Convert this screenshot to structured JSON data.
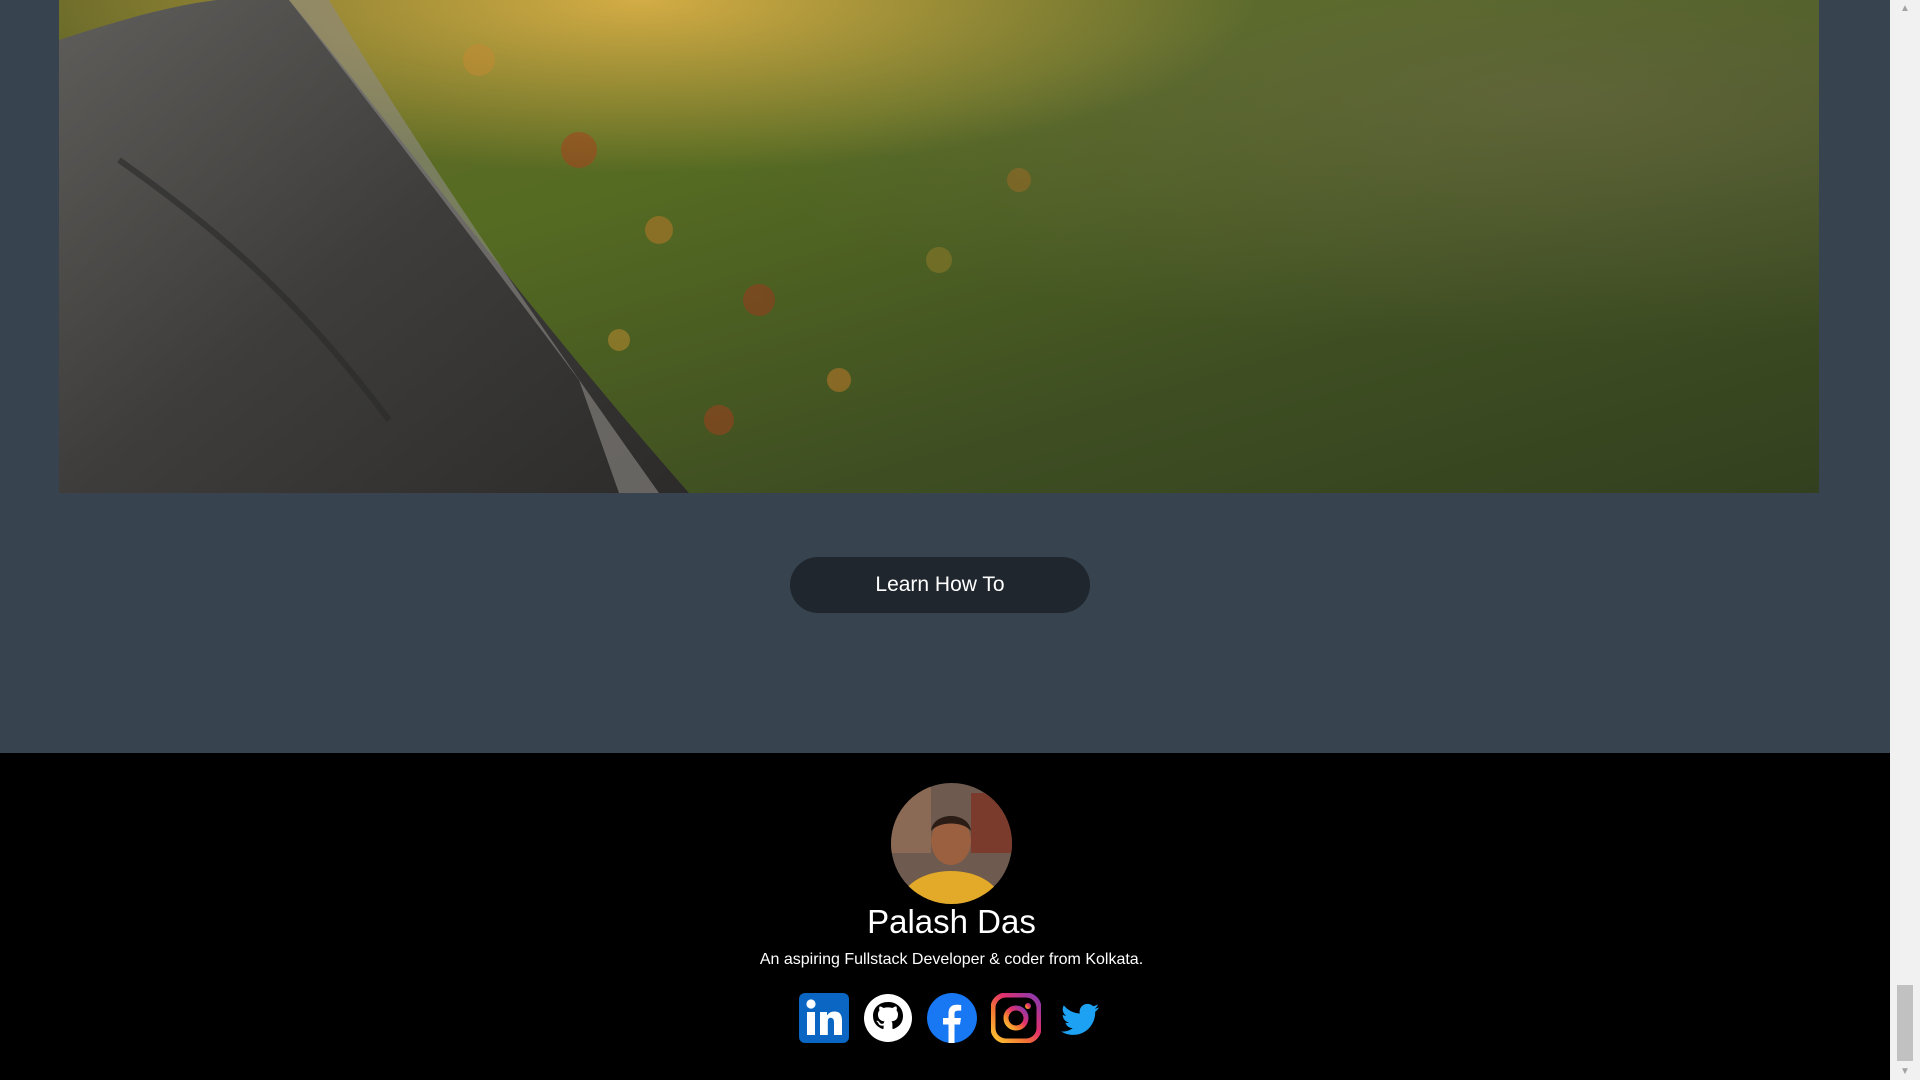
{
  "cta": {
    "label": "Learn How To"
  },
  "footer": {
    "name": "Palash Das",
    "tagline": "An aspiring Fullstack Developer & coder from Kolkata.",
    "socials": [
      {
        "icon": "linkedin-icon",
        "color": "#0a66c2"
      },
      {
        "icon": "github-icon",
        "color": "#ffffff"
      },
      {
        "icon": "facebook-icon",
        "color": "#1877f2"
      },
      {
        "icon": "instagram-icon",
        "color": "#e1306c"
      },
      {
        "icon": "twitter-icon",
        "color": "#1da1f2"
      }
    ]
  },
  "colors": {
    "page_bg": "#37444f",
    "button_bg": "#1f262d",
    "footer_bg": "#000000"
  }
}
